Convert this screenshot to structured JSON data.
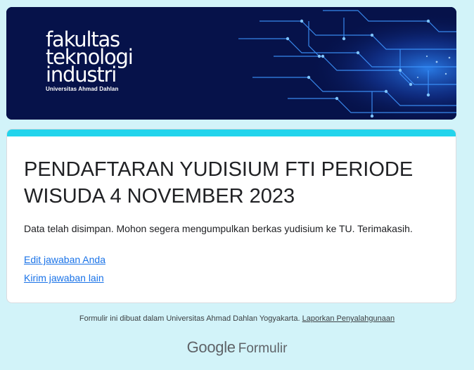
{
  "banner": {
    "logo_line1": "fakultas",
    "logo_line2": "teknologi",
    "logo_line3": "industri",
    "logo_university": "Universitas Ahmad Dahlan",
    "background_color": "#06124a",
    "circuit_color": "#2a8dff"
  },
  "form": {
    "accent_color": "#23d4ec",
    "title": "PENDAFTARAN YUDISIUM FTI PERIODE WISUDA 4 NOVEMBER 2023",
    "confirmation_message": "Data telah disimpan. Mohon segera mengumpulkan berkas yudisium ke TU. Terimakasih.",
    "edit_response_link": "Edit jawaban Anda",
    "submit_another_link": "Kirim jawaban lain",
    "link_color": "#1a73e8"
  },
  "footer": {
    "created_by_text": "Formulir ini dibuat dalam Universitas Ahmad Dahlan Yogyakarta.",
    "report_abuse_link": "Laporkan Penyalahgunaan",
    "brand_google": "Google",
    "brand_product": "Formulir"
  },
  "page": {
    "background_color": "#d2f3f9"
  }
}
